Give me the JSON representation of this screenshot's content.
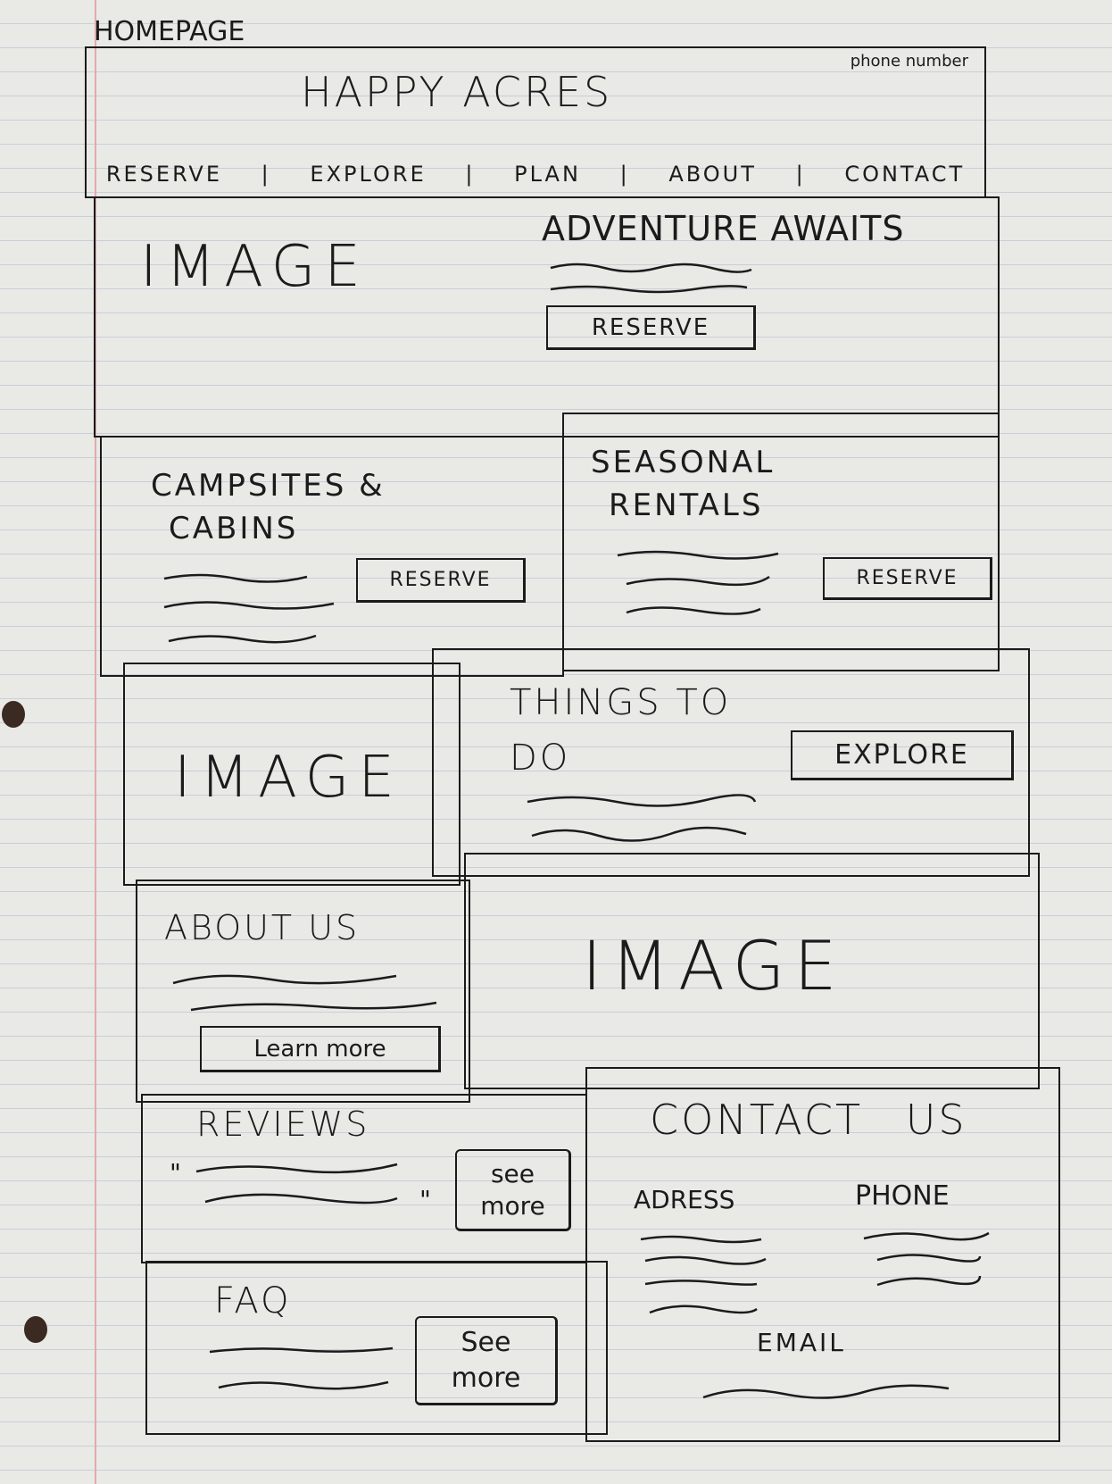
{
  "page_label": "HOMEPAGE",
  "header": {
    "title": "HAPPY ACRES",
    "phone": "phone number",
    "nav": [
      "RESERVE",
      "EXPLORE",
      "PLAN",
      "ABOUT",
      "CONTACT"
    ]
  },
  "hero": {
    "image": "IMAGE",
    "heading": "ADVENTURE AWAITS",
    "button": "RESERVE"
  },
  "campsites": {
    "heading_line1": "CAMPSITES &",
    "heading_line2": "CABINS",
    "button": "RESERVE"
  },
  "seasonal": {
    "heading_line1": "SEASONAL",
    "heading_line2": "RENTALS",
    "button": "RESERVE"
  },
  "things": {
    "image": "IMAGE",
    "heading_line1": "THINGS TO",
    "heading_line2": "DO",
    "button": "EXPLORE"
  },
  "about": {
    "heading": "ABOUT US",
    "button": "Learn more",
    "image": "IMAGE"
  },
  "reviews": {
    "heading": "REVIEWS",
    "open_quote": "\"",
    "close_quote": "\"",
    "button_line1": "see",
    "button_line2": "more"
  },
  "faq": {
    "heading": "FAQ",
    "button_line1": "See",
    "button_line2": "more"
  },
  "contact": {
    "heading": "CONTACT US",
    "address": "ADRESS",
    "phone": "PHONE",
    "email": "EMAIL"
  }
}
